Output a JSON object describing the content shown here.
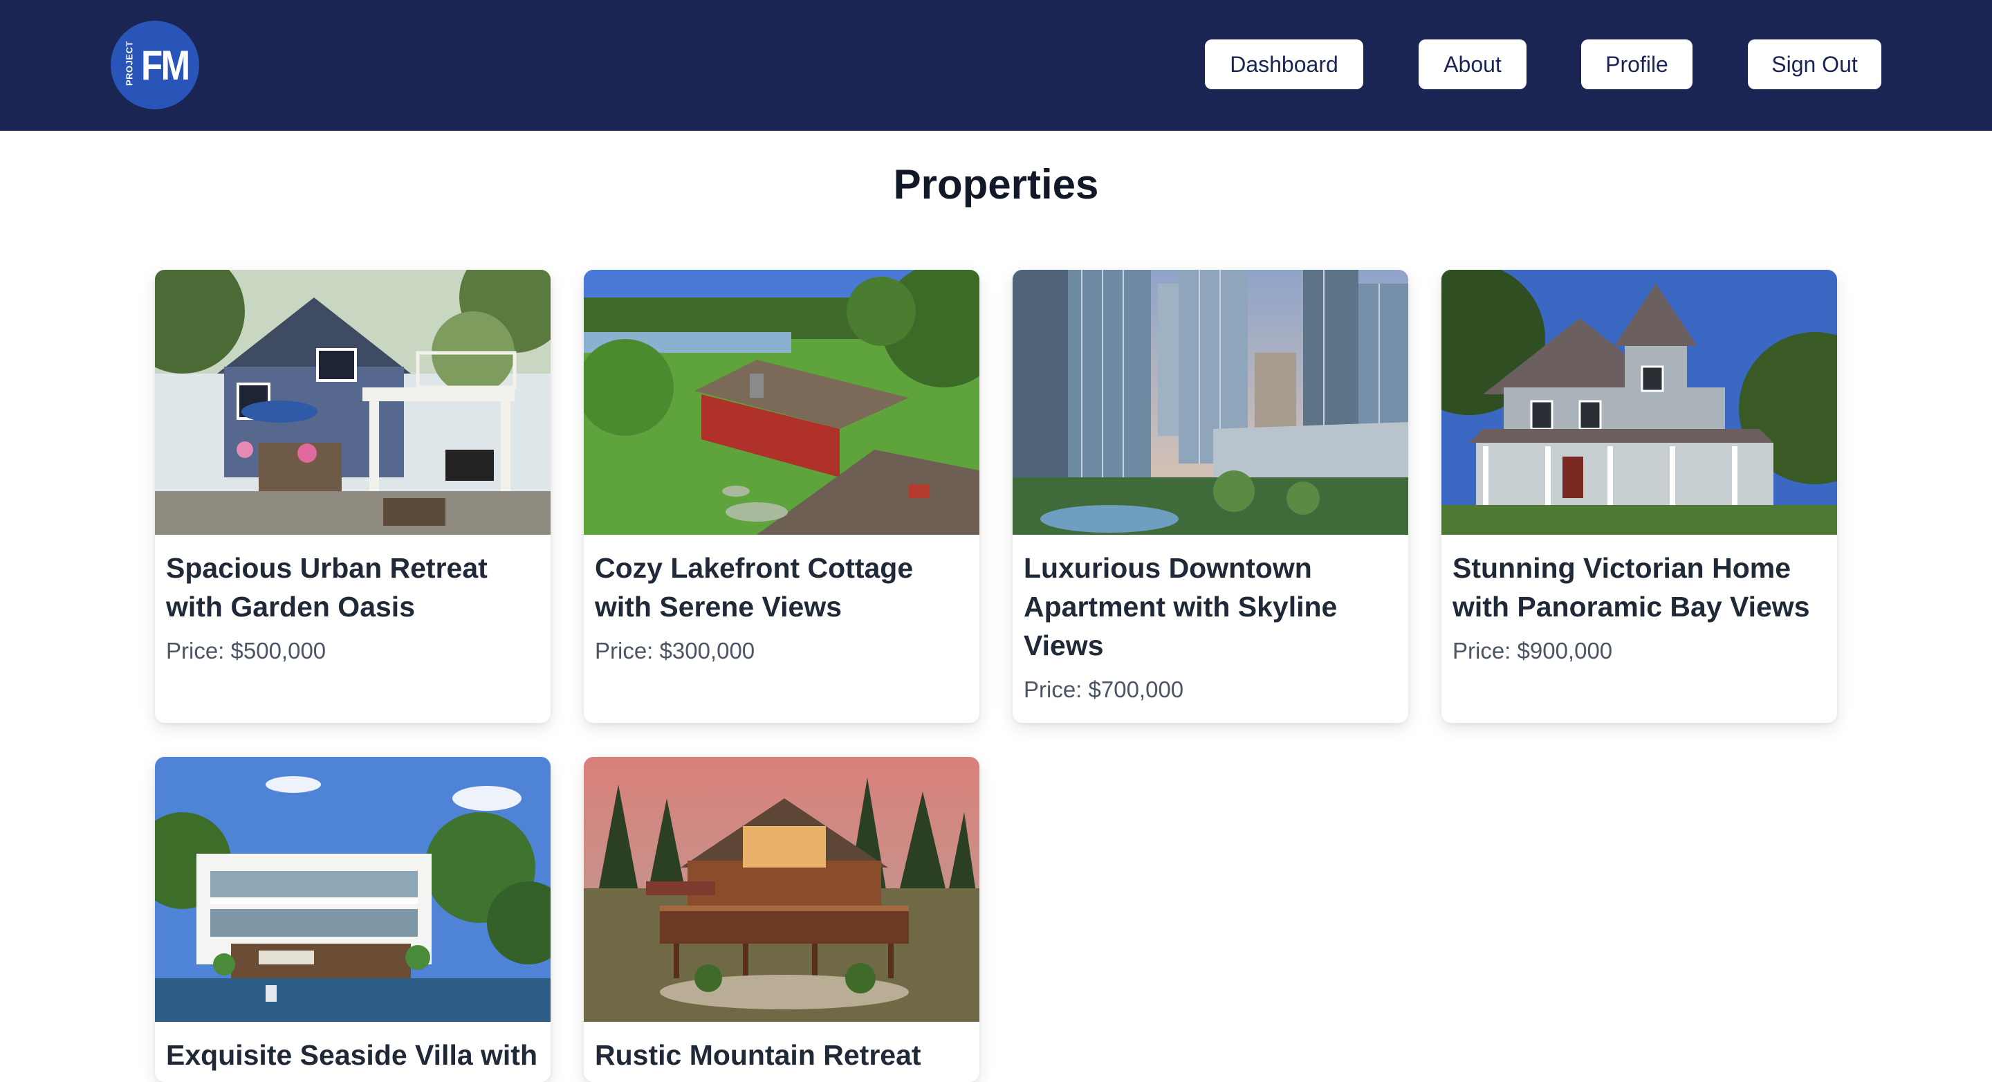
{
  "header": {
    "logo": {
      "small_text": "PROJECT",
      "large_text": "FM"
    },
    "nav": {
      "dashboard": "Dashboard",
      "about": "About",
      "profile": "Profile",
      "sign_out": "Sign Out"
    }
  },
  "page": {
    "title": "Properties"
  },
  "properties": [
    {
      "title": "Spacious Urban Retreat with Garden Oasis",
      "price": "Price: $500,000",
      "image": "suburban-house-photo"
    },
    {
      "title": "Cozy Lakefront Cottage with Serene Views",
      "price": "Price: $300,000",
      "image": "lake-cottage-photo"
    },
    {
      "title": "Luxurious Downtown Apartment with Skyline Views",
      "price": "Price: $700,000",
      "image": "city-skyline-photo"
    },
    {
      "title": "Stunning Victorian Home with Panoramic Bay Views",
      "price": "Price: $900,000",
      "image": "victorian-house-photo"
    },
    {
      "title": "Exquisite Seaside Villa with",
      "price": "",
      "image": "seaside-villa-photo"
    },
    {
      "title": "Rustic Mountain Retreat",
      "price": "",
      "image": "log-cabin-photo"
    }
  ],
  "colors": {
    "header_bg": "#1b2553",
    "logo_bg": "#2a55b8",
    "button_bg": "#ffffff"
  }
}
